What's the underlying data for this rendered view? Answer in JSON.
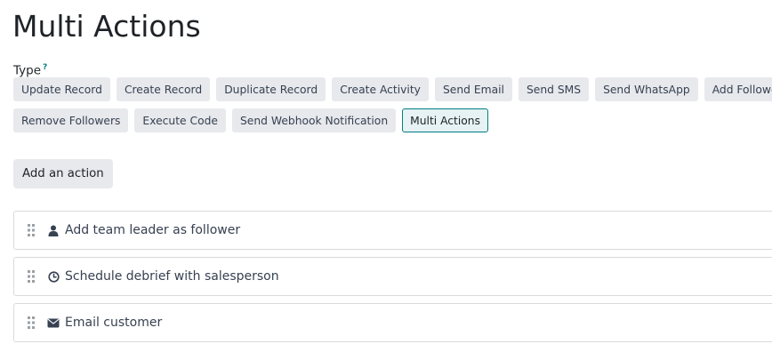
{
  "page": {
    "title": "Multi Actions"
  },
  "type_field": {
    "label": "Type",
    "help_marker": "?",
    "rows": [
      [
        {
          "label": "Update Record",
          "active": false
        },
        {
          "label": "Create Record",
          "active": false
        },
        {
          "label": "Duplicate Record",
          "active": false
        },
        {
          "label": "Create Activity",
          "active": false
        },
        {
          "label": "Send Email",
          "active": false
        },
        {
          "label": "Send SMS",
          "active": false
        },
        {
          "label": "Send WhatsApp",
          "active": false
        },
        {
          "label": "Add Followers",
          "active": false
        }
      ],
      [
        {
          "label": "Remove Followers",
          "active": false
        },
        {
          "label": "Execute Code",
          "active": false
        },
        {
          "label": "Send Webhook Notification",
          "active": false
        },
        {
          "label": "Multi Actions",
          "active": true
        }
      ]
    ]
  },
  "add_action": {
    "label": "Add an action"
  },
  "actions": [
    {
      "icon": "user-icon",
      "label": "Add team leader as follower"
    },
    {
      "icon": "clock-icon",
      "label": "Schedule debrief with salesperson"
    },
    {
      "icon": "envelope-icon",
      "label": "Email customer"
    }
  ],
  "colors": {
    "accent": "#017e84",
    "button_bg": "#e7e9ed",
    "active_bg": "#e6f2f3",
    "border": "#d8dadd"
  }
}
